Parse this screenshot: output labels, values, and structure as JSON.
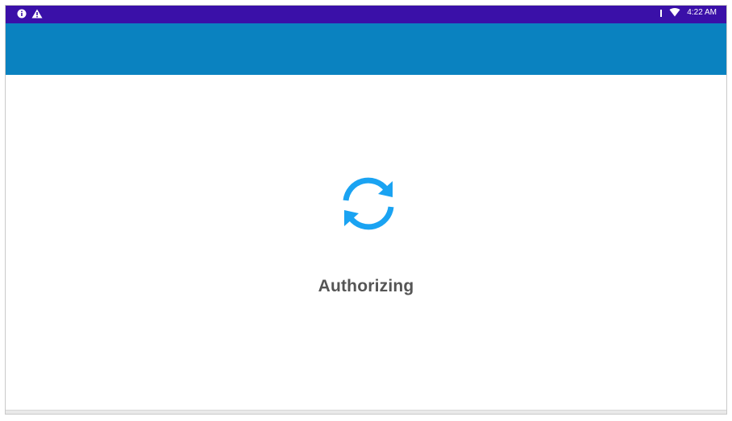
{
  "status_bar": {
    "icons_left": [
      "info-icon",
      "warning-icon"
    ],
    "signal_icon": "signal-icon",
    "wifi_icon": "wifi-icon",
    "time": "4:22 AM"
  },
  "content": {
    "spinner_icon": "refresh-sync-icon",
    "message": "Authorizing"
  },
  "colors": {
    "status_bar": "#3a10a8",
    "app_bar": "#0a82c0",
    "spinner": "#1aa3f2",
    "text": "#555555"
  }
}
